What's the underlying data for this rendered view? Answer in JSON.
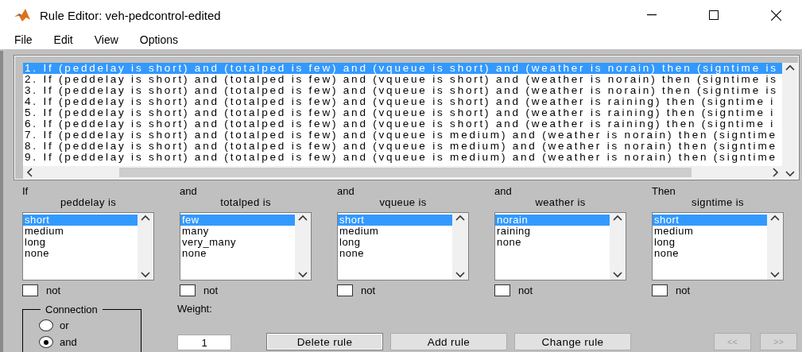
{
  "window": {
    "title": "Rule Editor: veh-pedcontrol-edited"
  },
  "menu": [
    "File",
    "Edit",
    "View",
    "Options"
  ],
  "rules": [
    {
      "text": "1. If (peddelay is short) and (totalped is few) and (vqueue is short) and (weather is norain) then (signtime is",
      "selected": true
    },
    {
      "text": "2. If (peddelay is short) and (totalped is few) and (vqueue is short) and (weather is norain) then (signtime is",
      "selected": false
    },
    {
      "text": "3. If (peddelay is short) and (totalped is few) and (vqueue is short) and (weather is norain) then (signtime is",
      "selected": false
    },
    {
      "text": "4. If (peddelay is short) and (totalped is few) and (vqueue is short) and (weather is raining) then (signtime i",
      "selected": false
    },
    {
      "text": "5. If (peddelay is short) and (totalped is few) and (vqueue is short) and (weather is raining) then (signtime i",
      "selected": false
    },
    {
      "text": "6. If (peddelay is short) and (totalped is few) and (vqueue is short) and (weather is raining) then (signtime i",
      "selected": false
    },
    {
      "text": "7. If (peddelay is short) and (totalped is few) and (vqueue is medium) and (weather is norain) then (signtime",
      "selected": false
    },
    {
      "text": "8. If (peddelay is short) and (totalped is few) and (vqueue is medium) and (weather is norain) then (signtime",
      "selected": false
    },
    {
      "text": "9. If (peddelay is short) and (totalped is few) and (vqueue is medium) and (weather is norain) then (signtime",
      "selected": false
    }
  ],
  "variables": [
    {
      "connector": "If",
      "name": "peddelay is",
      "not_checked": false,
      "options": [
        {
          "label": "short",
          "selected": true
        },
        {
          "label": "medium",
          "selected": false
        },
        {
          "label": "long",
          "selected": false
        },
        {
          "label": "none",
          "selected": false
        }
      ]
    },
    {
      "connector": "and",
      "name": "totalped is",
      "not_checked": false,
      "options": [
        {
          "label": "few",
          "selected": true
        },
        {
          "label": "many",
          "selected": false
        },
        {
          "label": "very_many",
          "selected": false
        },
        {
          "label": "none",
          "selected": false
        }
      ]
    },
    {
      "connector": "and",
      "name": "vqueue is",
      "not_checked": false,
      "options": [
        {
          "label": "short",
          "selected": true
        },
        {
          "label": "medium",
          "selected": false
        },
        {
          "label": "long",
          "selected": false
        },
        {
          "label": "none",
          "selected": false
        }
      ]
    },
    {
      "connector": "and",
      "name": "weather is",
      "not_checked": false,
      "options": [
        {
          "label": "norain",
          "selected": true
        },
        {
          "label": "raining",
          "selected": false
        },
        {
          "label": "none",
          "selected": false
        }
      ]
    },
    {
      "connector": "Then",
      "name": "signtime is",
      "not_checked": false,
      "options": [
        {
          "label": "short",
          "selected": true
        },
        {
          "label": "medium",
          "selected": false
        },
        {
          "label": "long",
          "selected": false
        },
        {
          "label": "none",
          "selected": false
        }
      ]
    }
  ],
  "not_labels": [
    "not",
    "not",
    "not",
    "not",
    "not"
  ],
  "connection": {
    "title": "Connection",
    "options": [
      {
        "label": "or",
        "selected": false
      },
      {
        "label": "and",
        "selected": true
      }
    ]
  },
  "weight": {
    "label": "Weight:",
    "value": "1"
  },
  "buttons": [
    {
      "label": "Delete rule",
      "kind": "focused",
      "disabled": false
    },
    {
      "label": "Add rule",
      "kind": "normal",
      "disabled": false
    },
    {
      "label": "Change rule",
      "kind": "normal",
      "disabled": false
    }
  ],
  "nav_buttons": [
    {
      "label": "<<",
      "disabled": true
    },
    {
      "label": ">>",
      "disabled": true
    }
  ]
}
